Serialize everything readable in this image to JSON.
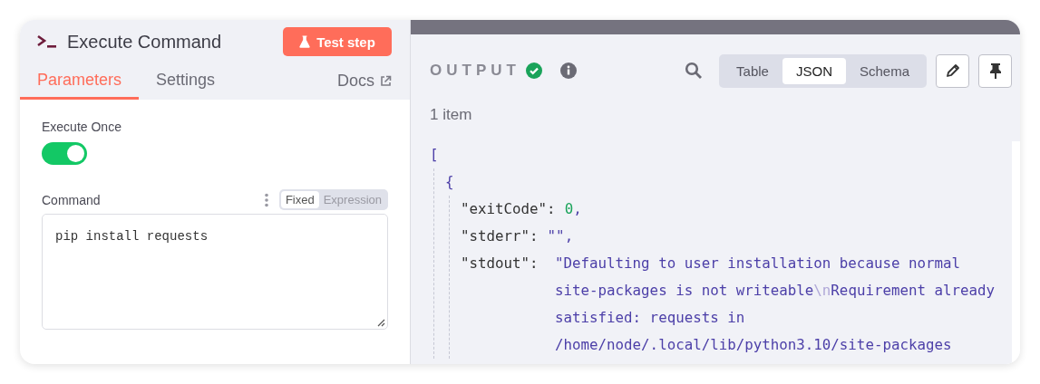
{
  "node": {
    "title": "Execute Command",
    "test_button": "Test step"
  },
  "tabs": [
    {
      "label": "Parameters",
      "selected": true
    },
    {
      "label": "Settings",
      "selected": false
    }
  ],
  "docs_link": "Docs",
  "parameters": {
    "execute_once": {
      "label": "Execute Once",
      "on": true
    },
    "command": {
      "label": "Command",
      "modes": [
        {
          "label": "Fixed",
          "selected": true
        },
        {
          "label": "Expression",
          "selected": false
        }
      ],
      "value": "pip install requests"
    }
  },
  "output": {
    "title": "OUTPUT",
    "success": true,
    "views": [
      {
        "label": "Table",
        "selected": false
      },
      {
        "label": "JSON",
        "selected": true
      },
      {
        "label": "Schema",
        "selected": false
      }
    ],
    "count": "1 item",
    "json": {
      "open_array": "[",
      "open_object": "{",
      "fields": [
        {
          "key": "\"exitCode\":",
          "kind": "number",
          "comma": ",",
          "lines": [
            [
              {
                "text": "0",
                "kind": "text"
              }
            ]
          ]
        },
        {
          "key": "\"stderr\":",
          "kind": "string",
          "comma": ",",
          "lines": [
            [
              {
                "text": "\"\"",
                "kind": "text"
              }
            ]
          ]
        },
        {
          "key": "\"stdout\":",
          "kind": "string",
          "lines": [
            [
              {
                "text": "\"Defaulting to user installation because normal",
                "kind": "text"
              }
            ],
            [
              {
                "text": "site-packages is not writeable",
                "kind": "text"
              },
              {
                "text": "\\n",
                "kind": "escape"
              },
              {
                "text": "Requirement already",
                "kind": "text"
              }
            ],
            [
              {
                "text": "satisfied: requests in",
                "kind": "text"
              }
            ],
            [
              {
                "text": "/home/node/.local/lib/python3.10/site-packages",
                "kind": "text"
              }
            ]
          ]
        }
      ]
    }
  }
}
